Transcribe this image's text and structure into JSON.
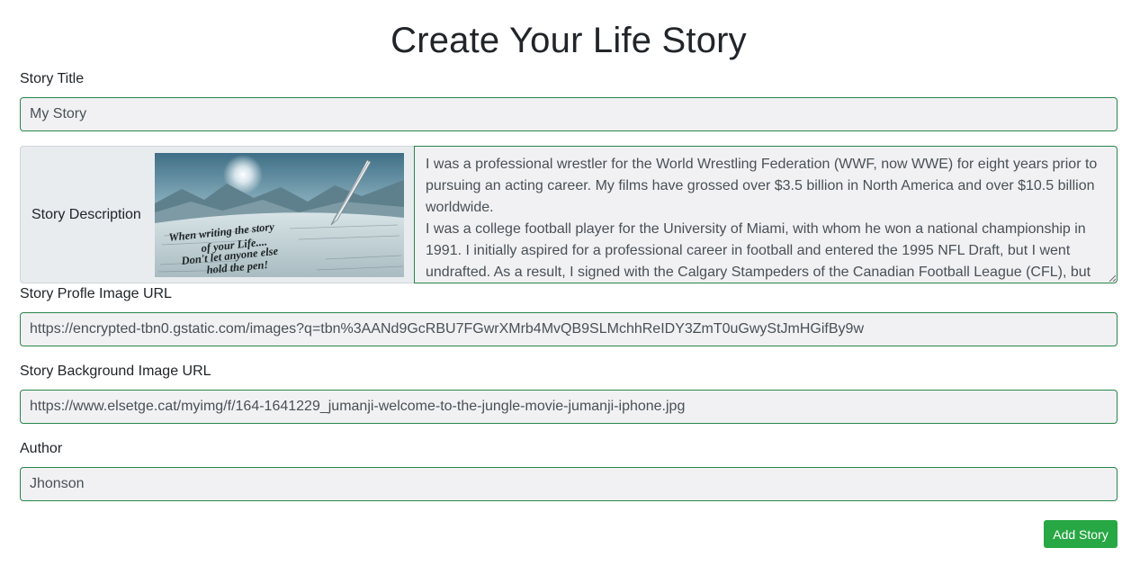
{
  "page": {
    "title": "Create Your Life Story"
  },
  "form": {
    "title_label": "Story Title",
    "title_value": "My Story",
    "description_label": "Story Description",
    "description_image_text": [
      "When writing the story",
      "of your Life....",
      "Don't let anyone else",
      "hold the pen!"
    ],
    "description_value": "I was a professional wrestler for the World Wrestling Federation (WWF, now WWE) for eight years prior to pursuing an acting career. My films have grossed over $3.5 billion in North America and over $10.5 billion worldwide.\nI was a college football player for the University of Miami, with whom he won a national championship in 1991. I initially aspired for a professional career in football and entered the 1995 NFL Draft, but I went undrafted. As a result, I signed with the Calgary Stampeders of the Canadian Football League (CFL), but",
    "profile_image_label": "Story Profle Image URL",
    "profile_image_value": "https://encrypted-tbn0.gstatic.com/images?q=tbn%3AANd9GcRBU7FGwrXMrb4MvQB9SLMchhReIDY3ZmT0uGwyStJmHGifBy9w",
    "background_image_label": "Story Background Image URL",
    "background_image_value": "https://www.elsetge.cat/myimg/f/164-1641229_jumanji-welcome-to-the-jungle-movie-jumanji-iphone.jpg",
    "author_label": "Author",
    "author_value": "Jhonson",
    "submit_label": "Add Story"
  },
  "colors": {
    "input_border": "#28864a",
    "input_background": "#f1f1f3",
    "button_background": "#28a745",
    "addon_background": "#e9ecef"
  }
}
